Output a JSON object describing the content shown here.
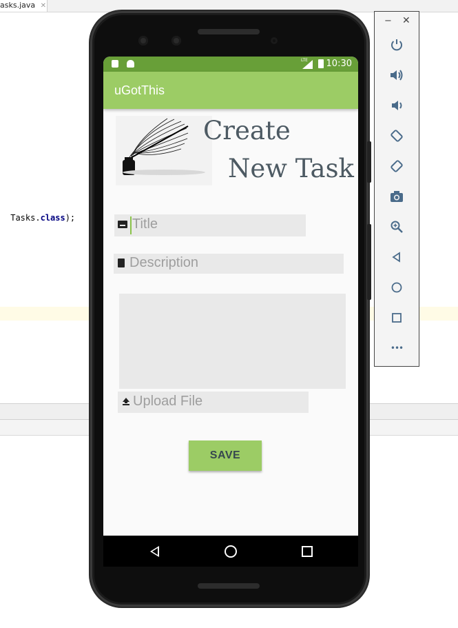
{
  "ide": {
    "tab_label": "asks.java",
    "tab_close": "✕",
    "code_prefix": " Tasks.",
    "code_keyword": "class",
    "code_suffix": ");"
  },
  "statusbar": {
    "time": "10:30",
    "network": "LTE"
  },
  "appbar": {
    "title": "uGotThis"
  },
  "header": {
    "line1": "Create",
    "line2": "New Task"
  },
  "form": {
    "title_placeholder": "Title",
    "description_placeholder": "Description",
    "upload_placeholder": "Upload File",
    "save_label": "SAVE"
  },
  "emulator": {
    "minimize": "−",
    "close": "✕",
    "buttons": [
      "power-icon",
      "volume-up-icon",
      "volume-down-icon",
      "rotate-left-icon",
      "rotate-right-icon",
      "camera-icon",
      "zoom-icon",
      "back-icon",
      "home-icon",
      "overview-icon",
      "more-icon"
    ],
    "more_label": "•••"
  },
  "colors": {
    "status_bar": "#689f38",
    "app_bar": "#9ccc65",
    "heading_text": "#4d5a63",
    "accent": "#8bc34a"
  }
}
